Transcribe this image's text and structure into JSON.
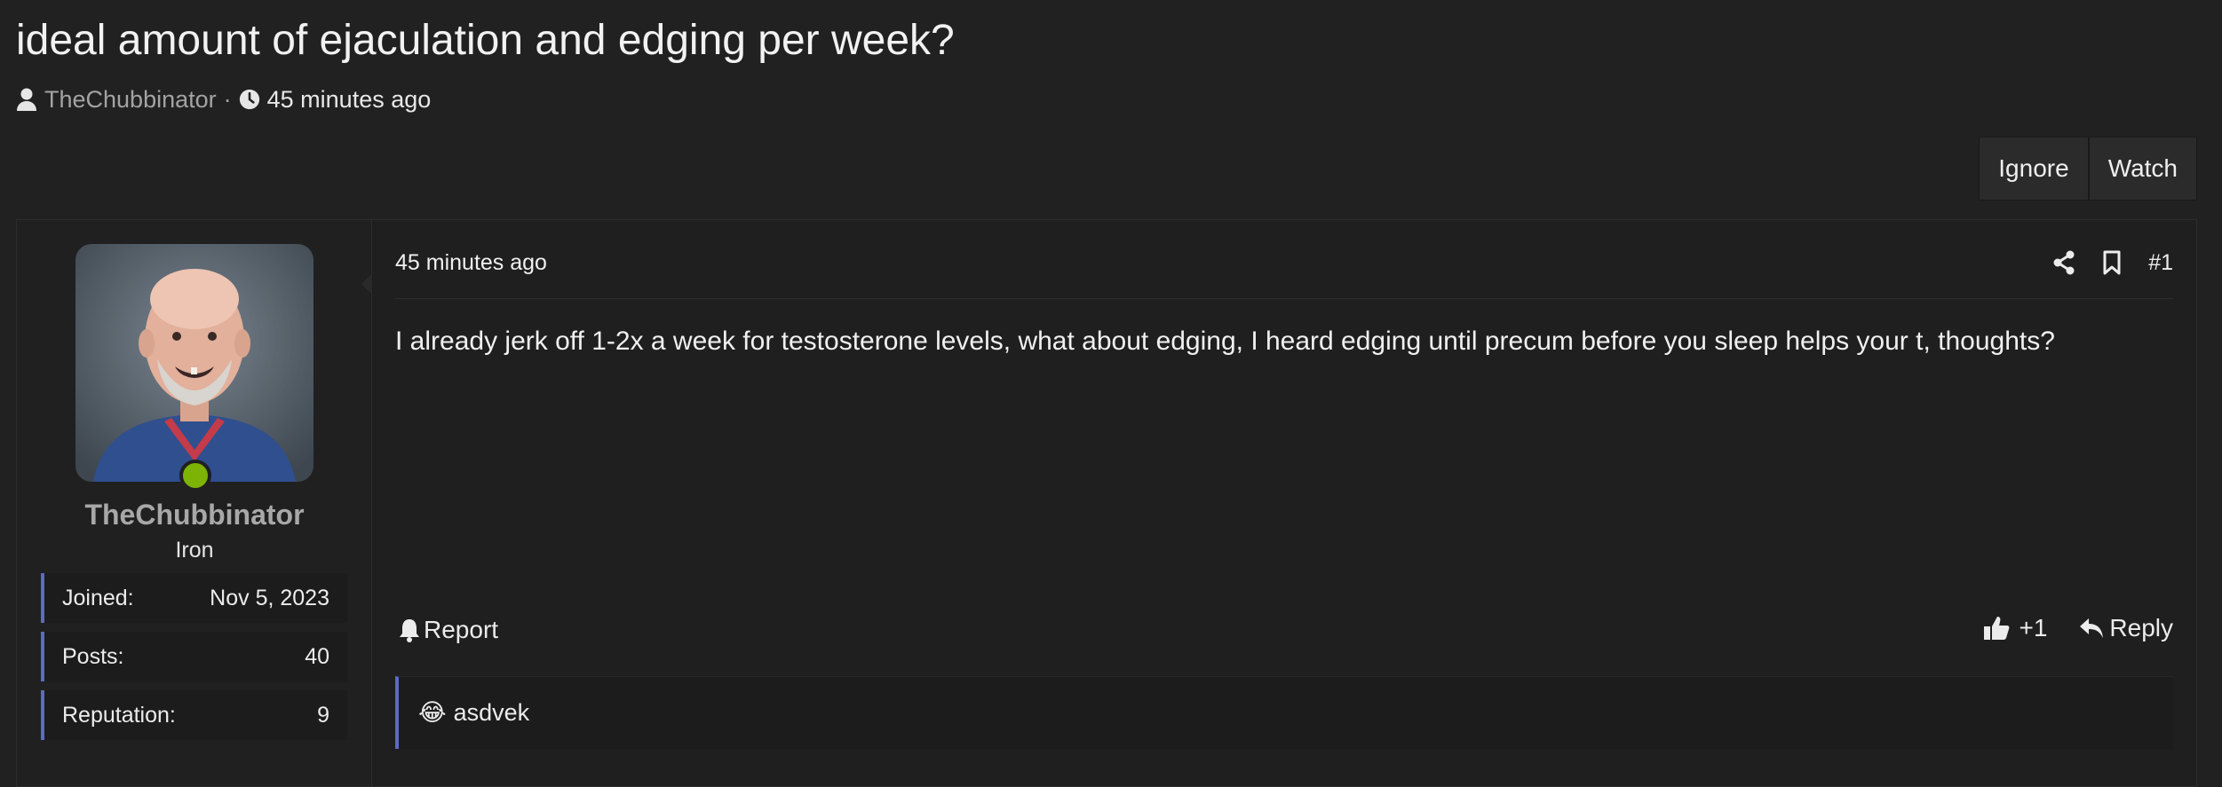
{
  "thread": {
    "title": "ideal amount of ejaculation and edging per week?",
    "author": "TheChubbinator",
    "separator": "·",
    "posted": "45 minutes ago"
  },
  "actions": {
    "ignore": "Ignore",
    "watch": "Watch"
  },
  "post": {
    "user": {
      "name": "TheChubbinator",
      "title": "Iron",
      "stats": [
        {
          "label": "Joined:",
          "value": "Nov 5, 2023"
        },
        {
          "label": "Posts:",
          "value": "40"
        },
        {
          "label": "Reputation:",
          "value": "9"
        }
      ]
    },
    "time": "45 minutes ago",
    "number": "#1",
    "body": "I already jerk off 1-2x a week for testosterone levels, what about edging, I heard edging until precum before you sleep helps your t, thoughts?",
    "report": "Report",
    "like_count": "+1",
    "reply": "Reply",
    "reaction_emoji": "😂",
    "reaction_user": "asdvek"
  },
  "colors": {
    "accent": "#5c6bc0",
    "online": "#7cb305",
    "background": "#212121"
  }
}
